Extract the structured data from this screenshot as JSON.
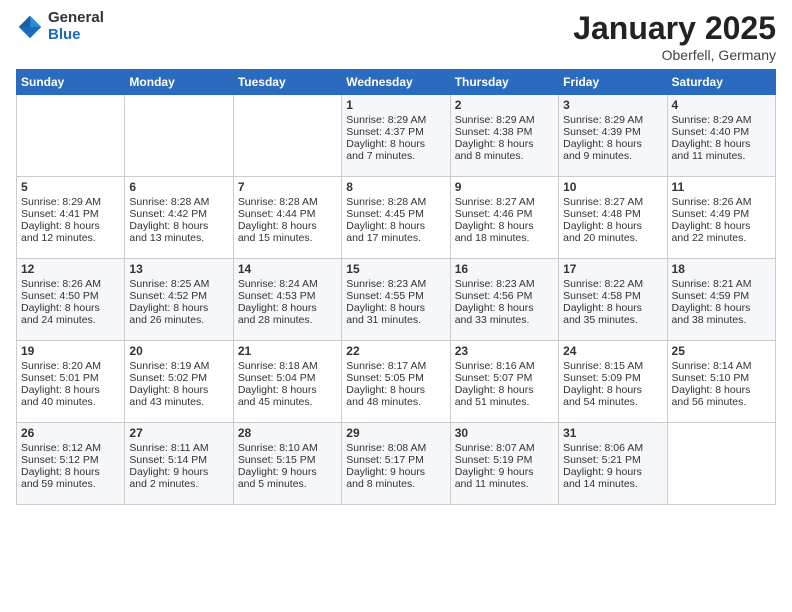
{
  "header": {
    "logo_general": "General",
    "logo_blue": "Blue",
    "month_title": "January 2025",
    "location": "Oberfell, Germany"
  },
  "days_of_week": [
    "Sunday",
    "Monday",
    "Tuesday",
    "Wednesday",
    "Thursday",
    "Friday",
    "Saturday"
  ],
  "weeks": [
    [
      {
        "day": "",
        "content": ""
      },
      {
        "day": "",
        "content": ""
      },
      {
        "day": "",
        "content": ""
      },
      {
        "day": "1",
        "content": "Sunrise: 8:29 AM\nSunset: 4:37 PM\nDaylight: 8 hours\nand 7 minutes."
      },
      {
        "day": "2",
        "content": "Sunrise: 8:29 AM\nSunset: 4:38 PM\nDaylight: 8 hours\nand 8 minutes."
      },
      {
        "day": "3",
        "content": "Sunrise: 8:29 AM\nSunset: 4:39 PM\nDaylight: 8 hours\nand 9 minutes."
      },
      {
        "day": "4",
        "content": "Sunrise: 8:29 AM\nSunset: 4:40 PM\nDaylight: 8 hours\nand 11 minutes."
      }
    ],
    [
      {
        "day": "5",
        "content": "Sunrise: 8:29 AM\nSunset: 4:41 PM\nDaylight: 8 hours\nand 12 minutes."
      },
      {
        "day": "6",
        "content": "Sunrise: 8:28 AM\nSunset: 4:42 PM\nDaylight: 8 hours\nand 13 minutes."
      },
      {
        "day": "7",
        "content": "Sunrise: 8:28 AM\nSunset: 4:44 PM\nDaylight: 8 hours\nand 15 minutes."
      },
      {
        "day": "8",
        "content": "Sunrise: 8:28 AM\nSunset: 4:45 PM\nDaylight: 8 hours\nand 17 minutes."
      },
      {
        "day": "9",
        "content": "Sunrise: 8:27 AM\nSunset: 4:46 PM\nDaylight: 8 hours\nand 18 minutes."
      },
      {
        "day": "10",
        "content": "Sunrise: 8:27 AM\nSunset: 4:48 PM\nDaylight: 8 hours\nand 20 minutes."
      },
      {
        "day": "11",
        "content": "Sunrise: 8:26 AM\nSunset: 4:49 PM\nDaylight: 8 hours\nand 22 minutes."
      }
    ],
    [
      {
        "day": "12",
        "content": "Sunrise: 8:26 AM\nSunset: 4:50 PM\nDaylight: 8 hours\nand 24 minutes."
      },
      {
        "day": "13",
        "content": "Sunrise: 8:25 AM\nSunset: 4:52 PM\nDaylight: 8 hours\nand 26 minutes."
      },
      {
        "day": "14",
        "content": "Sunrise: 8:24 AM\nSunset: 4:53 PM\nDaylight: 8 hours\nand 28 minutes."
      },
      {
        "day": "15",
        "content": "Sunrise: 8:23 AM\nSunset: 4:55 PM\nDaylight: 8 hours\nand 31 minutes."
      },
      {
        "day": "16",
        "content": "Sunrise: 8:23 AM\nSunset: 4:56 PM\nDaylight: 8 hours\nand 33 minutes."
      },
      {
        "day": "17",
        "content": "Sunrise: 8:22 AM\nSunset: 4:58 PM\nDaylight: 8 hours\nand 35 minutes."
      },
      {
        "day": "18",
        "content": "Sunrise: 8:21 AM\nSunset: 4:59 PM\nDaylight: 8 hours\nand 38 minutes."
      }
    ],
    [
      {
        "day": "19",
        "content": "Sunrise: 8:20 AM\nSunset: 5:01 PM\nDaylight: 8 hours\nand 40 minutes."
      },
      {
        "day": "20",
        "content": "Sunrise: 8:19 AM\nSunset: 5:02 PM\nDaylight: 8 hours\nand 43 minutes."
      },
      {
        "day": "21",
        "content": "Sunrise: 8:18 AM\nSunset: 5:04 PM\nDaylight: 8 hours\nand 45 minutes."
      },
      {
        "day": "22",
        "content": "Sunrise: 8:17 AM\nSunset: 5:05 PM\nDaylight: 8 hours\nand 48 minutes."
      },
      {
        "day": "23",
        "content": "Sunrise: 8:16 AM\nSunset: 5:07 PM\nDaylight: 8 hours\nand 51 minutes."
      },
      {
        "day": "24",
        "content": "Sunrise: 8:15 AM\nSunset: 5:09 PM\nDaylight: 8 hours\nand 54 minutes."
      },
      {
        "day": "25",
        "content": "Sunrise: 8:14 AM\nSunset: 5:10 PM\nDaylight: 8 hours\nand 56 minutes."
      }
    ],
    [
      {
        "day": "26",
        "content": "Sunrise: 8:12 AM\nSunset: 5:12 PM\nDaylight: 8 hours\nand 59 minutes."
      },
      {
        "day": "27",
        "content": "Sunrise: 8:11 AM\nSunset: 5:14 PM\nDaylight: 9 hours\nand 2 minutes."
      },
      {
        "day": "28",
        "content": "Sunrise: 8:10 AM\nSunset: 5:15 PM\nDaylight: 9 hours\nand 5 minutes."
      },
      {
        "day": "29",
        "content": "Sunrise: 8:08 AM\nSunset: 5:17 PM\nDaylight: 9 hours\nand 8 minutes."
      },
      {
        "day": "30",
        "content": "Sunrise: 8:07 AM\nSunset: 5:19 PM\nDaylight: 9 hours\nand 11 minutes."
      },
      {
        "day": "31",
        "content": "Sunrise: 8:06 AM\nSunset: 5:21 PM\nDaylight: 9 hours\nand 14 minutes."
      },
      {
        "day": "",
        "content": ""
      }
    ]
  ]
}
